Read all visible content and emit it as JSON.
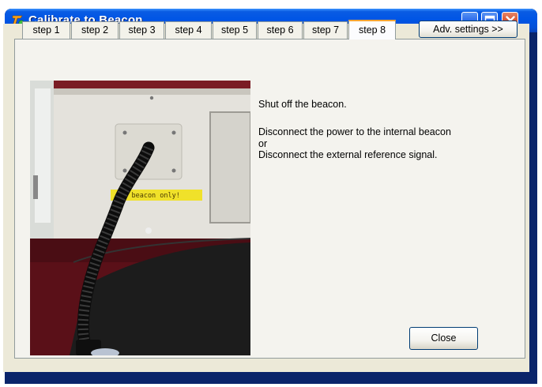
{
  "window": {
    "title": "Calibrate to Beacon"
  },
  "tabs": [
    {
      "label": "step 1",
      "active": false
    },
    {
      "label": "step 2",
      "active": false
    },
    {
      "label": "step 3",
      "active": false
    },
    {
      "label": "step 4",
      "active": false
    },
    {
      "label": "step 5",
      "active": false
    },
    {
      "label": "step 6",
      "active": false
    },
    {
      "label": "step 7",
      "active": false
    },
    {
      "label": "step 8",
      "active": true
    }
  ],
  "adv_settings_label": "Adv. settings >>",
  "photo": {
    "sign_text": "for beacon only!"
  },
  "instructions": {
    "line1": "Shut off the beacon.",
    "line2": "Disconnect the power to the internal beacon",
    "line3": "or",
    "line4": "Disconnect the external reference signal."
  },
  "close_label": "Close",
  "colors": {
    "titlebar": "#0055e5",
    "client": "#ece9d8",
    "active_tab_accent": "#f5a534"
  }
}
